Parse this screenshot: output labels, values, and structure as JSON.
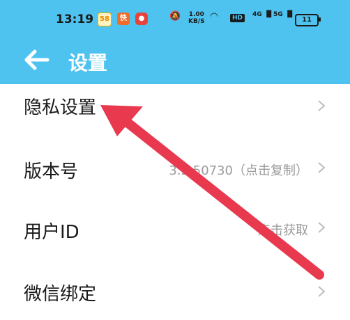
{
  "status_bar": {
    "time": "13:19",
    "app_icons": [
      "58",
      "快手",
      "网易云"
    ],
    "network_speed": "1.00",
    "network_unit": "KB/S",
    "hd_label": "HD",
    "sig1_label": "4G",
    "sig2_label": "5G",
    "battery": "11"
  },
  "header": {
    "title": "设置",
    "accent_color": "#4fc3ef"
  },
  "settings": [
    {
      "label": "隐私设置",
      "value": ""
    },
    {
      "label": "版本号",
      "value": "3.2.50730（点击复制）"
    },
    {
      "label": "用户ID",
      "value": "点击获取"
    },
    {
      "label": "微信绑定",
      "value": ""
    }
  ],
  "annotation": {
    "type": "red-arrow",
    "color": "#e8394e"
  }
}
